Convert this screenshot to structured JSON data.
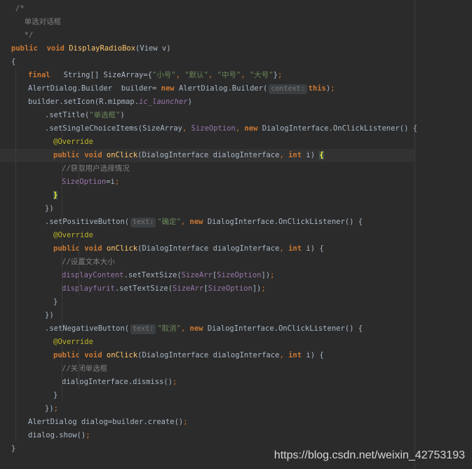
{
  "colors": {
    "background": "#2b2b2b",
    "current_line": "#323232",
    "default": "#a9b7c6",
    "comment": "#808080",
    "keyword": "#cc7832",
    "string": "#6a8759",
    "field": "#9876aa",
    "method_decl": "#ffc66d",
    "annotation": "#bbb529",
    "inlay_hint_bg": "#3b3f41"
  },
  "lines": [
    {
      "indent": 1,
      "highlight": false,
      "tokens": [
        {
          "t": "/*",
          "c": "comment"
        }
      ]
    },
    {
      "indent": 1,
      "highlight": false,
      "tokens": [
        {
          "t": "  单选对话框",
          "c": "comment"
        }
      ]
    },
    {
      "indent": 1,
      "highlight": false,
      "tokens": [
        {
          "t": "  */",
          "c": "comment"
        }
      ]
    },
    {
      "indent": 0,
      "highlight": false,
      "tokens": [
        {
          "t": "public",
          "c": "kw"
        },
        {
          "t": "  "
        },
        {
          "t": "void",
          "c": "kw"
        },
        {
          "t": " "
        },
        {
          "t": "DisplayRadioBox",
          "c": "fn"
        },
        {
          "t": "(View v)"
        }
      ]
    },
    {
      "indent": 0,
      "highlight": false,
      "tokens": [
        {
          "t": "{"
        }
      ]
    },
    {
      "indent": 4,
      "highlight": false,
      "tokens": [
        {
          "t": "final",
          "c": "kw"
        },
        {
          "t": "   String[] SizeArray={"
        },
        {
          "t": "\"小号\"",
          "c": "str"
        },
        {
          "t": ", ",
          "c": "punc"
        },
        {
          "t": "\"默认\"",
          "c": "str"
        },
        {
          "t": ", ",
          "c": "punc"
        },
        {
          "t": "\"中号\"",
          "c": "str"
        },
        {
          "t": ", ",
          "c": "punc"
        },
        {
          "t": "\"大号\"",
          "c": "str"
        },
        {
          "t": "}"
        },
        {
          "t": ";",
          "c": "punc"
        }
      ]
    },
    {
      "indent": 4,
      "highlight": false,
      "tokens": [
        {
          "t": "AlertDialog.Builder  builder= "
        },
        {
          "t": "new",
          "c": "kw"
        },
        {
          "t": " AlertDialog.Builder("
        },
        {
          "t": "context:",
          "c": "hint"
        },
        {
          "t": "this",
          "c": "kw"
        },
        {
          "t": ")"
        },
        {
          "t": ";",
          "c": "punc"
        }
      ]
    },
    {
      "indent": 4,
      "highlight": false,
      "tokens": [
        {
          "t": "builder.setIcon(R.mipmap."
        },
        {
          "t": "ic_launcher",
          "c": "field italic"
        },
        {
          "t": ")"
        }
      ]
    },
    {
      "indent": 8,
      "highlight": false,
      "tokens": [
        {
          "t": ".setTitle("
        },
        {
          "t": "\"单选框\"",
          "c": "str"
        },
        {
          "t": ")"
        }
      ]
    },
    {
      "indent": 8,
      "highlight": false,
      "tokens": [
        {
          "t": ".setSingleChoiceItems(SizeArray"
        },
        {
          "t": ", ",
          "c": "punc"
        },
        {
          "t": "SizeOption",
          "c": "field"
        },
        {
          "t": ", ",
          "c": "punc"
        },
        {
          "t": "new",
          "c": "kw"
        },
        {
          "t": " DialogInterface.OnClickListener() {"
        }
      ]
    },
    {
      "indent": 10,
      "highlight": false,
      "tokens": [
        {
          "t": "@Override",
          "c": "anno"
        }
      ]
    },
    {
      "indent": 10,
      "highlight": true,
      "tokens": [
        {
          "t": "public",
          "c": "kw"
        },
        {
          "t": " "
        },
        {
          "t": "void",
          "c": "kw"
        },
        {
          "t": " "
        },
        {
          "t": "onClick",
          "c": "fn"
        },
        {
          "t": "(DialogInterface dialogInterface"
        },
        {
          "t": ", ",
          "c": "punc"
        },
        {
          "t": "int",
          "c": "kw"
        },
        {
          "t": " i) "
        },
        {
          "t": "{",
          "c": "brace-match"
        }
      ]
    },
    {
      "indent": 12,
      "highlight": false,
      "tokens": [
        {
          "t": "//获取用户选择情况",
          "c": "comment"
        }
      ]
    },
    {
      "indent": 12,
      "highlight": false,
      "tokens": [
        {
          "t": "SizeOption",
          "c": "field"
        },
        {
          "t": "=i"
        },
        {
          "t": ";",
          "c": "punc"
        }
      ]
    },
    {
      "indent": 10,
      "highlight": false,
      "tokens": [
        {
          "t": "}",
          "c": "brace-match"
        }
      ]
    },
    {
      "indent": 8,
      "highlight": false,
      "tokens": [
        {
          "t": "})"
        }
      ]
    },
    {
      "indent": 8,
      "highlight": false,
      "tokens": [
        {
          "t": ".setPositiveButton("
        },
        {
          "t": "text:",
          "c": "hint"
        },
        {
          "t": "\"确定\"",
          "c": "str"
        },
        {
          "t": ", ",
          "c": "punc"
        },
        {
          "t": "new",
          "c": "kw"
        },
        {
          "t": " DialogInterface.OnClickListener() {"
        }
      ]
    },
    {
      "indent": 10,
      "highlight": false,
      "tokens": [
        {
          "t": "@Override",
          "c": "anno"
        }
      ]
    },
    {
      "indent": 10,
      "highlight": false,
      "tokens": [
        {
          "t": "public",
          "c": "kw"
        },
        {
          "t": " "
        },
        {
          "t": "void",
          "c": "kw"
        },
        {
          "t": " "
        },
        {
          "t": "onClick",
          "c": "fn"
        },
        {
          "t": "(DialogInterface dialogInterface"
        },
        {
          "t": ", ",
          "c": "punc"
        },
        {
          "t": "int",
          "c": "kw"
        },
        {
          "t": " i) {"
        }
      ]
    },
    {
      "indent": 12,
      "highlight": false,
      "tokens": [
        {
          "t": "//设置文本大小",
          "c": "comment"
        }
      ]
    },
    {
      "indent": 12,
      "highlight": false,
      "tokens": [
        {
          "t": "displayContent",
          "c": "field"
        },
        {
          "t": ".setTextSize("
        },
        {
          "t": "SizeArr",
          "c": "field"
        },
        {
          "t": "["
        },
        {
          "t": "SizeOption",
          "c": "field"
        },
        {
          "t": "])"
        },
        {
          "t": ";",
          "c": "punc"
        }
      ]
    },
    {
      "indent": 12,
      "highlight": false,
      "tokens": [
        {
          "t": "displayfurit",
          "c": "field"
        },
        {
          "t": ".setTextSize("
        },
        {
          "t": "SizeArr",
          "c": "field"
        },
        {
          "t": "["
        },
        {
          "t": "SizeOption",
          "c": "field"
        },
        {
          "t": "])"
        },
        {
          "t": ";",
          "c": "punc"
        }
      ]
    },
    {
      "indent": 10,
      "highlight": false,
      "tokens": [
        {
          "t": "}"
        }
      ]
    },
    {
      "indent": 8,
      "highlight": false,
      "tokens": [
        {
          "t": "})"
        }
      ]
    },
    {
      "indent": 8,
      "highlight": false,
      "tokens": [
        {
          "t": ".setNegativeButton("
        },
        {
          "t": "text:",
          "c": "hint"
        },
        {
          "t": "\"取消\"",
          "c": "str"
        },
        {
          "t": ", ",
          "c": "punc"
        },
        {
          "t": "new",
          "c": "kw"
        },
        {
          "t": " DialogInterface.OnClickListener() {"
        }
      ]
    },
    {
      "indent": 10,
      "highlight": false,
      "tokens": [
        {
          "t": "@Override",
          "c": "anno"
        }
      ]
    },
    {
      "indent": 10,
      "highlight": false,
      "tokens": [
        {
          "t": "public",
          "c": "kw"
        },
        {
          "t": " "
        },
        {
          "t": "void",
          "c": "kw"
        },
        {
          "t": " "
        },
        {
          "t": "onClick",
          "c": "fn"
        },
        {
          "t": "(DialogInterface dialogInterface"
        },
        {
          "t": ", ",
          "c": "punc"
        },
        {
          "t": "int",
          "c": "kw"
        },
        {
          "t": " i) {"
        }
      ]
    },
    {
      "indent": 12,
      "highlight": false,
      "tokens": [
        {
          "t": "//关闭单选框",
          "c": "comment"
        }
      ]
    },
    {
      "indent": 12,
      "highlight": false,
      "tokens": [
        {
          "t": "dialogInterface.dismiss()"
        },
        {
          "t": ";",
          "c": "punc"
        }
      ]
    },
    {
      "indent": 10,
      "highlight": false,
      "tokens": [
        {
          "t": "}"
        }
      ]
    },
    {
      "indent": 8,
      "highlight": false,
      "tokens": [
        {
          "t": "})"
        },
        {
          "t": ";",
          "c": "punc"
        }
      ]
    },
    {
      "indent": 4,
      "highlight": false,
      "tokens": [
        {
          "t": "AlertDialog dialog=builder.create()"
        },
        {
          "t": ";",
          "c": "punc"
        }
      ]
    },
    {
      "indent": 4,
      "highlight": false,
      "tokens": [
        {
          "t": "dialog.show()"
        },
        {
          "t": ";",
          "c": "punc"
        }
      ]
    },
    {
      "indent": 0,
      "highlight": false,
      "tokens": [
        {
          "t": "}"
        }
      ]
    }
  ],
  "watermark": "https://blog.csdn.net/weixin_42753193"
}
